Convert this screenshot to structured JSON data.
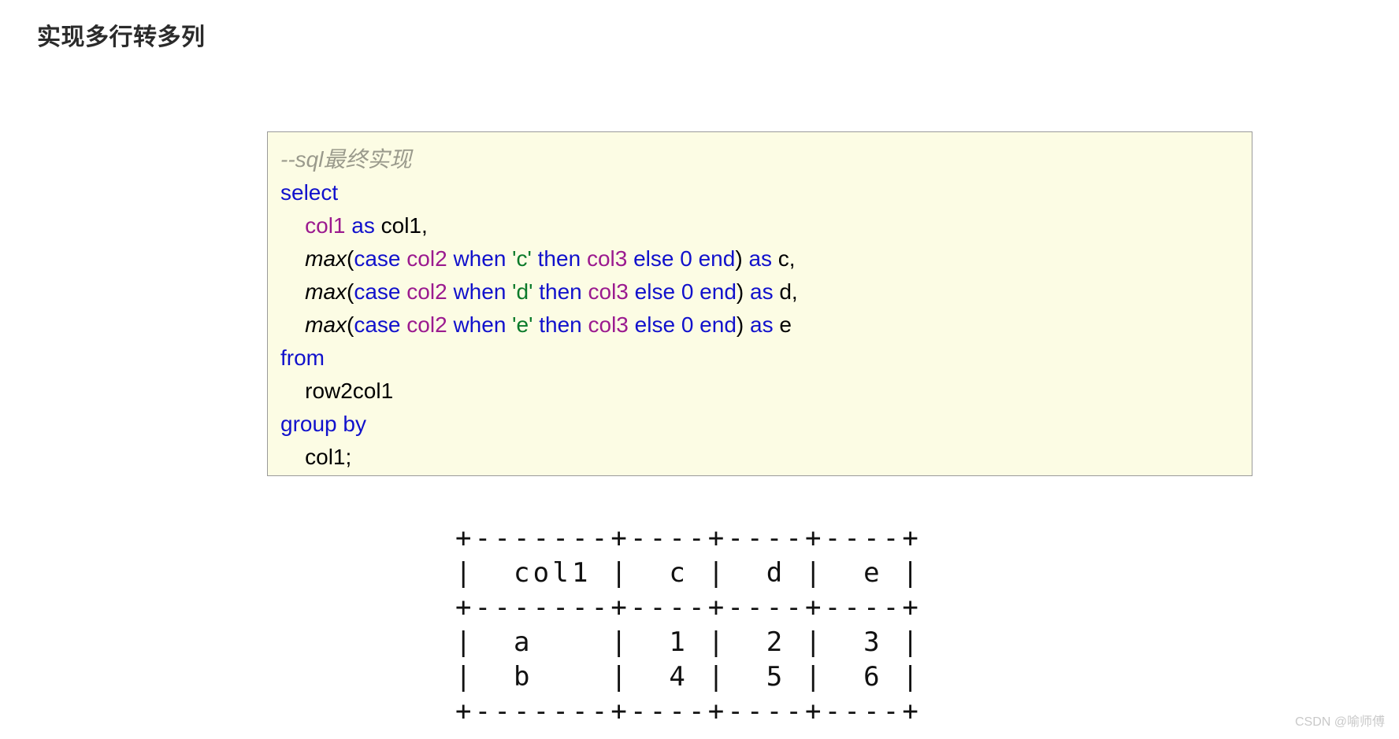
{
  "page": {
    "title": "实现多行转多列",
    "watermark": "CSDN @喻师傅",
    "background_color": "#ffffff"
  },
  "code_block": {
    "background_color": "#fcfce4",
    "border_color": "#9a9a9a",
    "language": "sql",
    "token_colors": {
      "comment": "#9a9a8c",
      "keyword": "#1111cc",
      "column": "#9b1a8f",
      "string": "#0a7a2a",
      "number": "#1111cc",
      "function": "#000000",
      "plain": "#000000"
    },
    "lines": [
      {
        "id": "line-1",
        "tokens": [
          {
            "t": "--sql最终实现",
            "c": "comment"
          }
        ]
      },
      {
        "id": "line-2",
        "tokens": [
          {
            "t": "select",
            "c": "kw"
          }
        ]
      },
      {
        "id": "line-3",
        "tokens": [
          {
            "t": "    ",
            "c": "plain"
          },
          {
            "t": "col1",
            "c": "col"
          },
          {
            "t": " ",
            "c": "plain"
          },
          {
            "t": "as",
            "c": "kw"
          },
          {
            "t": " col1,",
            "c": "plain"
          }
        ]
      },
      {
        "id": "line-4",
        "tokens": [
          {
            "t": "    ",
            "c": "plain"
          },
          {
            "t": "max",
            "c": "fn"
          },
          {
            "t": "(",
            "c": "plain"
          },
          {
            "t": "case",
            "c": "kw"
          },
          {
            "t": " ",
            "c": "plain"
          },
          {
            "t": "col2",
            "c": "col"
          },
          {
            "t": " ",
            "c": "plain"
          },
          {
            "t": "when",
            "c": "kw"
          },
          {
            "t": " ",
            "c": "plain"
          },
          {
            "t": "'c'",
            "c": "str"
          },
          {
            "t": " ",
            "c": "plain"
          },
          {
            "t": "then",
            "c": "kw"
          },
          {
            "t": " ",
            "c": "plain"
          },
          {
            "t": "col3",
            "c": "col"
          },
          {
            "t": " ",
            "c": "plain"
          },
          {
            "t": "else",
            "c": "kw"
          },
          {
            "t": " ",
            "c": "plain"
          },
          {
            "t": "0",
            "c": "num"
          },
          {
            "t": " ",
            "c": "plain"
          },
          {
            "t": "end",
            "c": "kw"
          },
          {
            "t": ")",
            "c": "plain"
          },
          {
            "t": " ",
            "c": "plain"
          },
          {
            "t": "as",
            "c": "kw"
          },
          {
            "t": " c,",
            "c": "plain"
          }
        ]
      },
      {
        "id": "line-5",
        "tokens": [
          {
            "t": "    ",
            "c": "plain"
          },
          {
            "t": "max",
            "c": "fn"
          },
          {
            "t": "(",
            "c": "plain"
          },
          {
            "t": "case",
            "c": "kw"
          },
          {
            "t": " ",
            "c": "plain"
          },
          {
            "t": "col2",
            "c": "col"
          },
          {
            "t": " ",
            "c": "plain"
          },
          {
            "t": "when",
            "c": "kw"
          },
          {
            "t": " ",
            "c": "plain"
          },
          {
            "t": "'d'",
            "c": "str"
          },
          {
            "t": " ",
            "c": "plain"
          },
          {
            "t": "then",
            "c": "kw"
          },
          {
            "t": " ",
            "c": "plain"
          },
          {
            "t": "col3",
            "c": "col"
          },
          {
            "t": " ",
            "c": "plain"
          },
          {
            "t": "else",
            "c": "kw"
          },
          {
            "t": " ",
            "c": "plain"
          },
          {
            "t": "0",
            "c": "num"
          },
          {
            "t": " ",
            "c": "plain"
          },
          {
            "t": "end",
            "c": "kw"
          },
          {
            "t": ")",
            "c": "plain"
          },
          {
            "t": " ",
            "c": "plain"
          },
          {
            "t": "as",
            "c": "kw"
          },
          {
            "t": " d,",
            "c": "plain"
          }
        ]
      },
      {
        "id": "line-6",
        "tokens": [
          {
            "t": "    ",
            "c": "plain"
          },
          {
            "t": "max",
            "c": "fn"
          },
          {
            "t": "(",
            "c": "plain"
          },
          {
            "t": "case",
            "c": "kw"
          },
          {
            "t": " ",
            "c": "plain"
          },
          {
            "t": "col2",
            "c": "col"
          },
          {
            "t": " ",
            "c": "plain"
          },
          {
            "t": "when",
            "c": "kw"
          },
          {
            "t": " ",
            "c": "plain"
          },
          {
            "t": "'e'",
            "c": "str"
          },
          {
            "t": " ",
            "c": "plain"
          },
          {
            "t": "then",
            "c": "kw"
          },
          {
            "t": " ",
            "c": "plain"
          },
          {
            "t": "col3",
            "c": "col"
          },
          {
            "t": " ",
            "c": "plain"
          },
          {
            "t": "else",
            "c": "kw"
          },
          {
            "t": " ",
            "c": "plain"
          },
          {
            "t": "0",
            "c": "num"
          },
          {
            "t": " ",
            "c": "plain"
          },
          {
            "t": "end",
            "c": "kw"
          },
          {
            "t": ")",
            "c": "plain"
          },
          {
            "t": " ",
            "c": "plain"
          },
          {
            "t": "as",
            "c": "kw"
          },
          {
            "t": " e",
            "c": "plain"
          }
        ]
      },
      {
        "id": "line-7",
        "tokens": [
          {
            "t": "from",
            "c": "kw"
          }
        ]
      },
      {
        "id": "line-8",
        "tokens": [
          {
            "t": "    row2col1",
            "c": "plain"
          }
        ]
      },
      {
        "id": "line-9",
        "tokens": [
          {
            "t": "group by",
            "c": "kw"
          }
        ]
      },
      {
        "id": "line-10",
        "tokens": [
          {
            "t": "    col1;",
            "c": "plain"
          }
        ]
      }
    ]
  },
  "result_table": {
    "columns": [
      "col1",
      "c",
      "d",
      "e"
    ],
    "rows": [
      [
        "a",
        "1",
        "2",
        "3"
      ],
      [
        "b",
        "4",
        "5",
        "6"
      ]
    ],
    "ascii": "+-------+----+----+----+\n|  col1 |  c |  d |  e |\n+-------+----+----+----+\n|  a    |  1 |  2 |  3 |\n|  b    |  4 |  5 |  6 |\n+-------+----+----+----+"
  }
}
